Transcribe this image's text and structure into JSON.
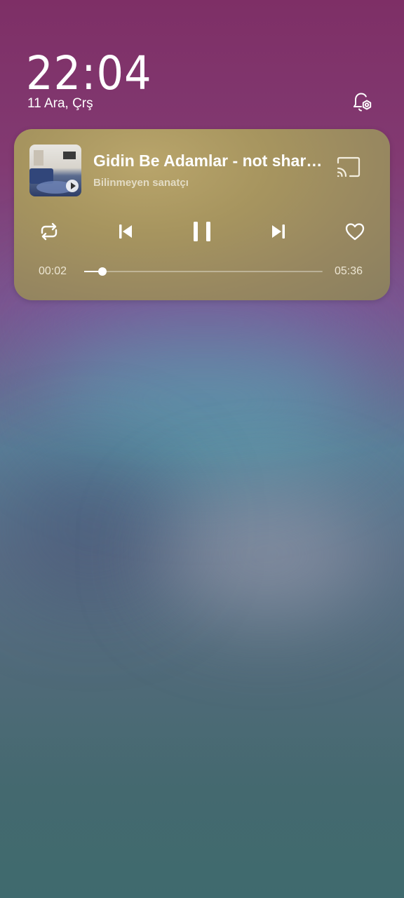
{
  "lockscreen": {
    "time": "22:04",
    "date": "11 Ara, Çrş"
  },
  "icons": {
    "notification_settings": "bell-gear-icon",
    "cast": "cast-icon",
    "repeat": "repeat-icon",
    "previous": "skip-previous-icon",
    "pause": "pause-icon",
    "next": "skip-next-icon",
    "like": "heart-icon"
  },
  "player": {
    "title": "Gidin Be Adamlar - not shared",
    "artist": "Bilinmeyen sanatçı",
    "elapsed": "00:02",
    "duration": "05:36",
    "progress_fraction": 0.006
  },
  "colors": {
    "card_accent": "#a7955f",
    "text": "#ffffff"
  }
}
